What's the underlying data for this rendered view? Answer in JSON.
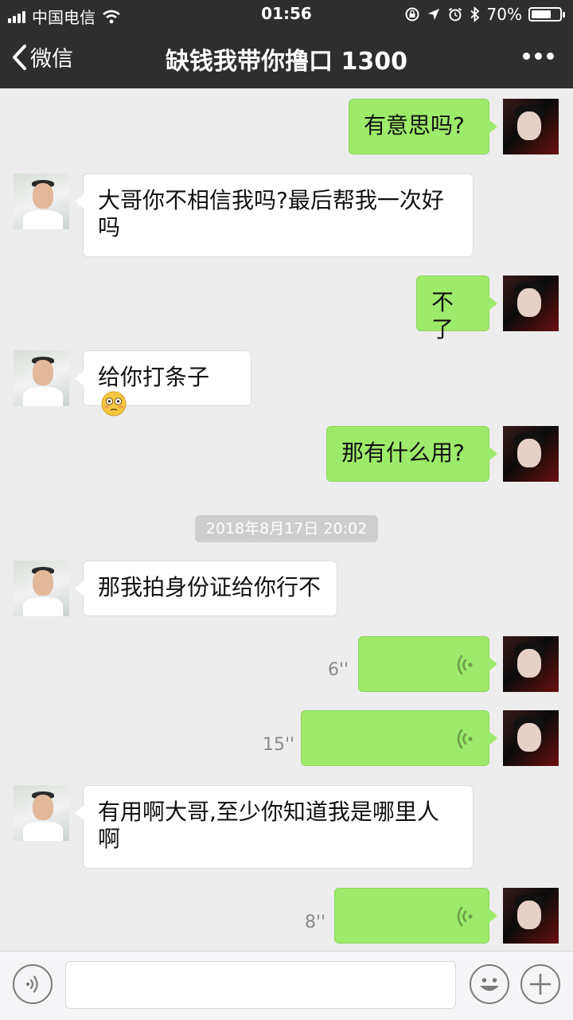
{
  "status_bar": {
    "carrier": "中国电信",
    "time": "01:56",
    "battery_text": "70%",
    "battery_level": 0.7
  },
  "nav": {
    "back_label": "微信",
    "title": "缺钱我带你撸口 1300"
  },
  "messages": [
    {
      "side": "me",
      "type": "text",
      "text": "有意思吗?"
    },
    {
      "side": "them",
      "type": "text",
      "line1": "大哥你不相信我吗?最后帮我一次好",
      "line2": "吗"
    },
    {
      "side": "me",
      "type": "text",
      "text": "不了"
    },
    {
      "side": "them",
      "type": "text",
      "text": "给你打条子",
      "emoji": "flushed-face-emoji"
    },
    {
      "side": "me",
      "type": "text",
      "text": "那有什么用?"
    },
    {
      "side": "system",
      "type": "timestamp",
      "text": "2018年8月17日 20:02"
    },
    {
      "side": "them",
      "type": "text",
      "text": "那我拍身份证给你行不"
    },
    {
      "side": "me",
      "type": "voice",
      "duration": "6''"
    },
    {
      "side": "me",
      "type": "voice",
      "duration": "15''"
    },
    {
      "side": "them",
      "type": "text",
      "line1": "有用啊大哥,至少你知道我是哪里人",
      "line2": "啊"
    },
    {
      "side": "me",
      "type": "voice",
      "duration": "8''"
    }
  ],
  "input_bar": {
    "voice_toggle_icon": "voice-mode-icon",
    "emoji_icon": "emoji-icon",
    "plus_icon": "plus-icon",
    "message_value": ""
  },
  "colors": {
    "header_bg": "#2e2e2e",
    "chat_bg": "#ededed",
    "my_bubble": "#9eea6a",
    "their_bubble": "#ffffff"
  }
}
